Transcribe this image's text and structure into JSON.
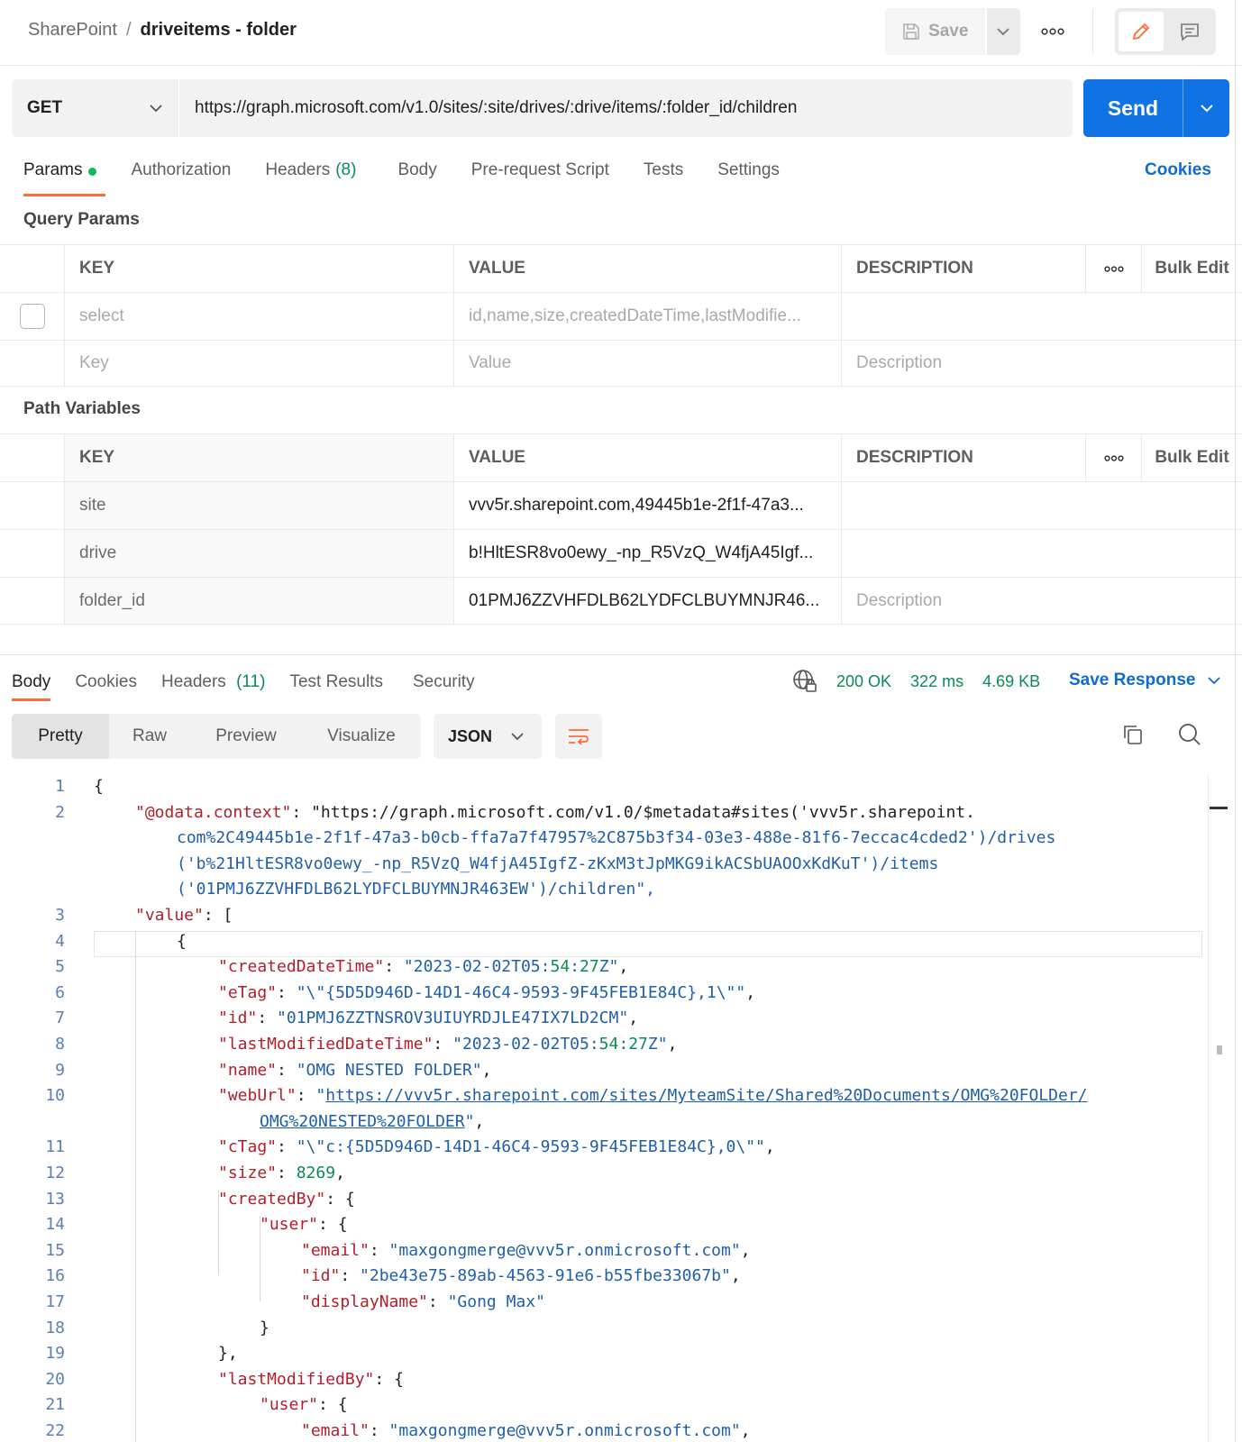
{
  "header": {
    "breadcrumb_parent": "SharePoint",
    "breadcrumb_sep": "/",
    "breadcrumb_current": "driveitems - folder",
    "save_label": "Save"
  },
  "request": {
    "method": "GET",
    "url": "https://graph.microsoft.com/v1.0/sites/:site/drives/:drive/items/:folder_id/children",
    "send_label": "Send"
  },
  "req_tabs": {
    "params": "Params",
    "authorization": "Authorization",
    "headers": "Headers",
    "headers_count": "(8)",
    "body": "Body",
    "prerequest": "Pre-request Script",
    "tests": "Tests",
    "settings": "Settings",
    "cookies": "Cookies"
  },
  "query_params": {
    "title": "Query Params",
    "columns": {
      "key": "KEY",
      "value": "VALUE",
      "description": "DESCRIPTION",
      "bulk_edit": "Bulk Edit"
    },
    "rows": [
      {
        "key": "select",
        "value": "id,name,size,createdDateTime,lastModifie..."
      }
    ],
    "placeholder": {
      "key": "Key",
      "value": "Value",
      "description": "Description"
    }
  },
  "path_variables": {
    "title": "Path Variables",
    "columns": {
      "key": "KEY",
      "value": "VALUE",
      "description": "DESCRIPTION",
      "bulk_edit": "Bulk Edit"
    },
    "rows": [
      {
        "key": "site",
        "value": "vvv5r.sharepoint.com,49445b1e-2f1f-47a3..."
      },
      {
        "key": "drive",
        "value": "b!HltESR8vo0ewy_-np_R5VzQ_W4fjA45Igf..."
      },
      {
        "key": "folder_id",
        "value": "01PMJ6ZZVHFDLB62LYDFCLBUYMNJR46...",
        "description_placeholder": "Description"
      }
    ]
  },
  "response": {
    "tabs": {
      "body": "Body",
      "cookies": "Cookies",
      "headers": "Headers",
      "headers_count": "(11)",
      "test_results": "Test Results",
      "security": "Security"
    },
    "status": "200 OK",
    "time": "322 ms",
    "size": "4.69 KB",
    "save_response": "Save Response",
    "views": [
      "Pretty",
      "Raw",
      "Preview",
      "Visualize"
    ],
    "format": "JSON"
  },
  "code": {
    "line_numbers": [
      "1",
      "2",
      "3",
      "4",
      "5",
      "6",
      "7",
      "8",
      "9",
      "10",
      "11",
      "12",
      "13",
      "14",
      "15",
      "16",
      "17",
      "18",
      "19",
      "20",
      "21",
      "22"
    ],
    "lines": [
      "{",
      "\"@odata.context\": \"https://graph.microsoft.com/v1.0/$metadata#sites('vvv5r.sharepoint.",
      "com%2C49445b1e-2f1f-47a3-b0cb-ffa7a7f47957%2C875b3f34-03e3-488e-81f6-7eccac4cded2')/drives",
      "('b%21HltESR8vo0ewy_-np_R5VzQ_W4fjA45IgfZ-zKxM3tJpMKG9ikACSbUAOOxKdKuT')/items",
      "('01PMJ6ZZVHFDLB62LYDFCLBUYMNJR463EW')/children\",",
      "\"value\": [",
      "{",
      "\"createdDateTime\": \"2023-02-02T05:54:27Z\",",
      "\"eTag\": \"\\\"{5D5D946D-14D1-46C4-9593-9F45FEB1E84C},1\\\"\",",
      "\"id\": \"01PMJ6ZZTNSROV3UIUYRDJLE47IX7LD2CM\",",
      "\"lastModifiedDateTime\": \"2023-02-02T05:54:27Z\",",
      "\"name\": \"OMG NESTED FOLDER\",",
      "\"webUrl\": \"https://vvv5r.sharepoint.com/sites/MyteamSite/Shared%20Documents/OMG%20FOLDer/",
      "OMG%20NESTED%20FOLDER\",",
      "\"cTag\": \"\\\"c:{5D5D946D-14D1-46C4-9593-9F45FEB1E84C},0\\\"\",",
      "\"size\": 8269,",
      "\"createdBy\": {",
      "\"user\": {",
      "\"email\": \"maxgongmerge@vvv5r.onmicrosoft.com\",",
      "\"id\": \"2be43e75-89ab-4563-91e6-b55fbe33067b\",",
      "\"displayName\": \"Gong Max\"",
      "}",
      "},",
      "\"lastModifiedBy\": {",
      "\"user\": {",
      "\"email\": \"maxgongmerge@vvv5r.onmicrosoft.com\","
    ]
  },
  "icons": {
    "save": "floppy-disk-icon",
    "more": "more-horizontal-icon",
    "edit": "pencil-icon",
    "comments": "comment-icon",
    "globe": "globe-lock-icon",
    "copy": "copy-icon",
    "search": "search-icon",
    "wrap": "wrap-lines-icon"
  },
  "colors": {
    "accent": "#ff6c37",
    "send": "#0f72e5",
    "link": "#0f6bd0",
    "success": "#0a8a55",
    "json_key": "#b21e2a",
    "json_string": "#1f5fa8"
  }
}
